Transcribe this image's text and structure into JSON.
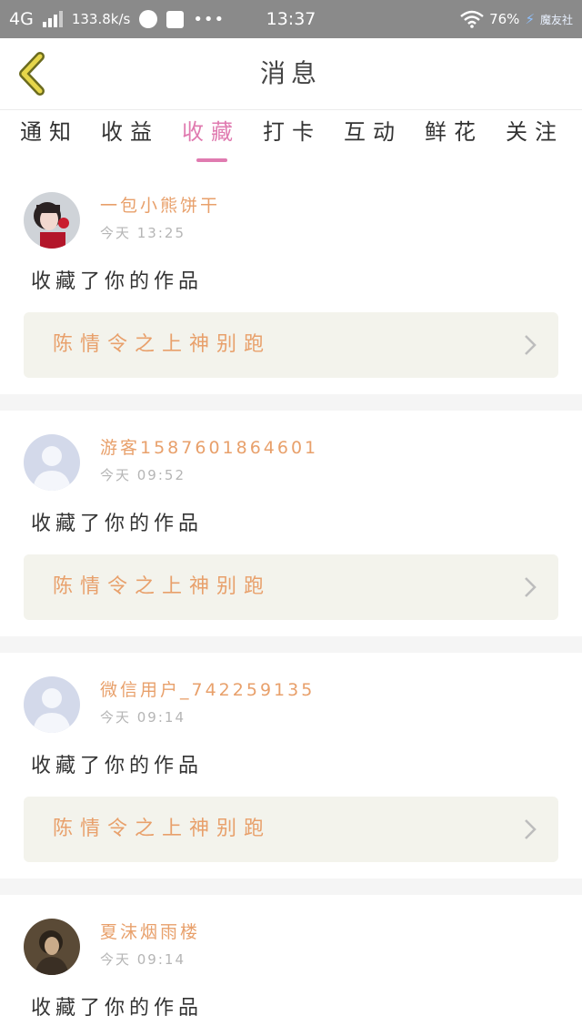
{
  "status_bar": {
    "network": "4G",
    "speed": "133.8k/s",
    "dots": "•••",
    "time": "13:37",
    "battery": "76%",
    "brand": "魔友社"
  },
  "header": {
    "title": "消息"
  },
  "tabs": [
    {
      "label": "通知"
    },
    {
      "label": "收益"
    },
    {
      "label": "收藏"
    },
    {
      "label": "打卡"
    },
    {
      "label": "互动"
    },
    {
      "label": "鲜花"
    },
    {
      "label": "关注"
    }
  ],
  "active_tab": "收藏",
  "colors": {
    "accent_pink": "#e07bb0",
    "name_orange": "#e8a06b",
    "card_bg": "#f3f3ec"
  },
  "messages": [
    {
      "user": "一包小熊饼干",
      "time": "今天 13:25",
      "action": "收藏了你的作品",
      "work": "陈情令之上神别跑",
      "avatar": "photo-avatar-girl"
    },
    {
      "user": "游客1587601864601",
      "time": "今天 09:52",
      "action": "收藏了你的作品",
      "work": "陈情令之上神别跑",
      "avatar": "default-avatar"
    },
    {
      "user": "微信用户_742259135",
      "time": "今天 09:14",
      "action": "收藏了你的作品",
      "work": "陈情令之上神别跑",
      "avatar": "default-avatar"
    },
    {
      "user": "夏沫烟雨楼",
      "time": "今天 09:14",
      "action": "收藏了你的作品",
      "work": "",
      "avatar": "photo-avatar-dark"
    }
  ]
}
